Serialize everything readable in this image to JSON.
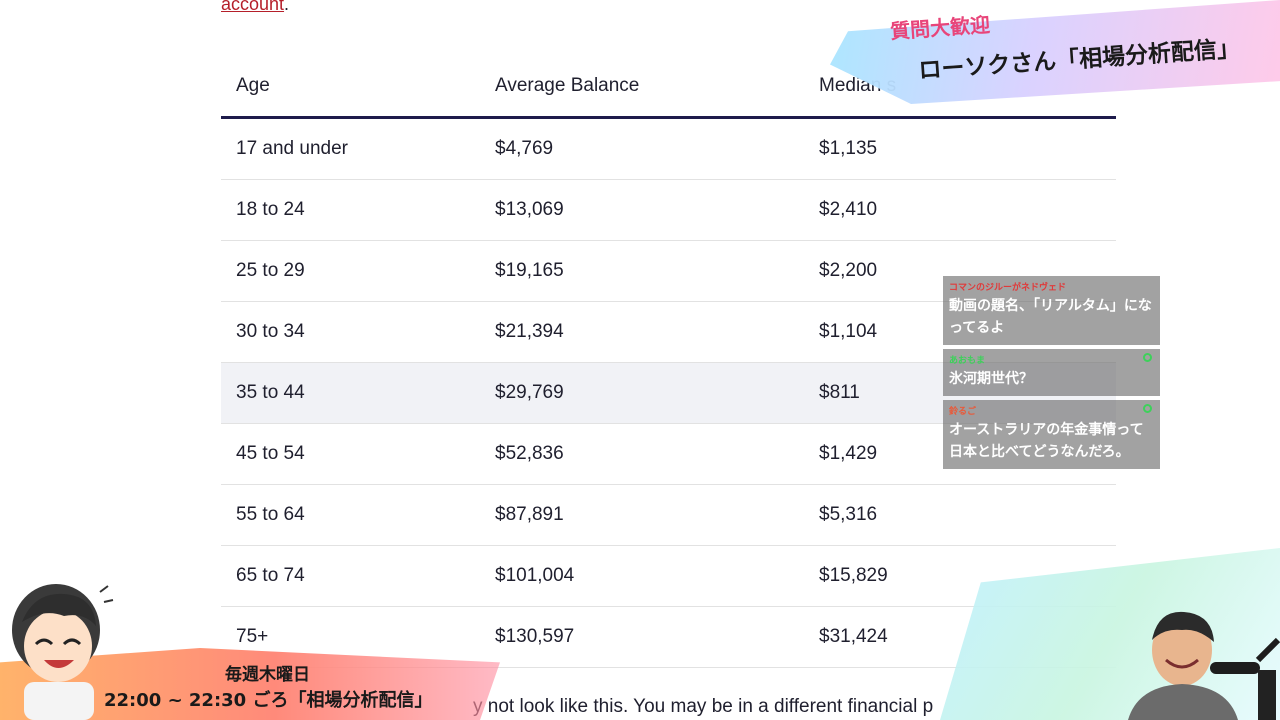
{
  "article": {
    "link_text": "account",
    "link_suffix": ".",
    "bottom_text": "y not look like this. You may be in a different financial p"
  },
  "table": {
    "headers": [
      "Age",
      "Average Balance",
      "Median s"
    ],
    "rows": [
      [
        "17 and under",
        "$4,769",
        "$1,135"
      ],
      [
        "18 to 24",
        "$13,069",
        "$2,410"
      ],
      [
        "25 to 29",
        "$19,165",
        "$2,200"
      ],
      [
        "30 to 34",
        "$21,394",
        "$1,104"
      ],
      [
        "35 to 44",
        "$29,769",
        "$811"
      ],
      [
        "45 to 54",
        "$52,836",
        "$1,429"
      ],
      [
        "55 to 64",
        "$87,891",
        "$5,316"
      ],
      [
        "65 to 74",
        "$101,004",
        "$15,829"
      ],
      [
        "75+",
        "$130,597",
        "$31,424"
      ]
    ],
    "highlighted_row_index": 4
  },
  "overlay": {
    "banner_small": "質問大歓迎",
    "banner_big": "ローソクさん「相場分析配信」",
    "schedule_day": "毎週木曜日",
    "schedule_time": "22:00 ~ 22:30 ごろ「相場分析配信」"
  },
  "chat": [
    {
      "author": "コマンのジルーがネドヴェド",
      "author_color": "#e03a3a",
      "text": "動画の題名、「リアルタム」になってるよ",
      "badge": false
    },
    {
      "author": "あおもま",
      "author_color": "#3dd15a",
      "text": "氷河期世代？",
      "badge": true
    },
    {
      "author": "鈴るご",
      "author_color": "#e85a3a",
      "text": "オーストラリアの年金事情って日本と比べてどうなんだろ。",
      "badge": true
    }
  ],
  "colors": {
    "link": "#b51f2a",
    "header_rule": "#1e1b4b",
    "row_highlight": "#f1f2f6"
  },
  "icons": {
    "avatar": "illustrated-avatar-icon",
    "webcam": "webcam-person"
  }
}
